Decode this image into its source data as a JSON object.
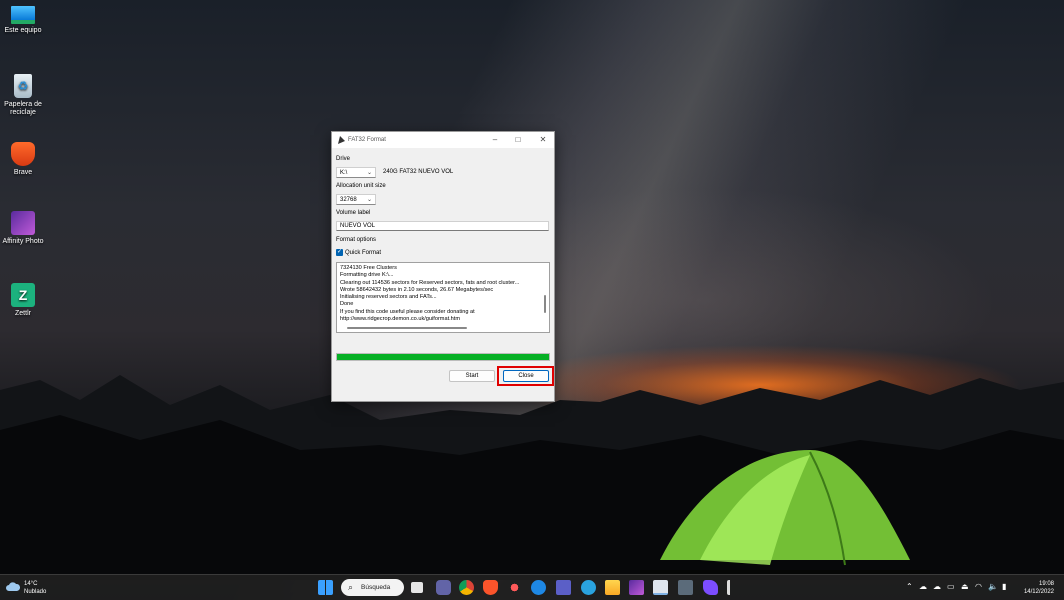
{
  "desktop": {
    "icons": [
      {
        "label": "Este equipo"
      },
      {
        "label": "Papelera de reciclaje"
      },
      {
        "label": "Brave"
      },
      {
        "label": "Affinity Photo"
      },
      {
        "label": "Zettlr"
      }
    ]
  },
  "dialog": {
    "title": "FAT32 Format",
    "drive_label": "Drive",
    "drive_value": "K:\\",
    "drive_info": "240G FAT32 NUEVO VOL",
    "alloc_label": "Allocation unit size",
    "alloc_value": "32768",
    "volume_label_label": "Volume label",
    "volume_label_value": "NUEVO VOL",
    "format_options_label": "Format options",
    "quick_format_label": "Quick Format",
    "quick_format_checked": true,
    "log_lines": [
      "7324130 Free Clusters",
      "Formatting drive K:\\...",
      "Clearing out 114536 sectors for Reserved sectors, fats and root cluster...",
      "Wrote 58642432 bytes in 2.10 seconds, 26.67 Megabytes/sec",
      "Initialising reserved sectors and FATs...",
      "Done",
      "If you find this code useful please consider donating at",
      "http://www.ridgecrop.demon.co.uk/guiformat.htm"
    ],
    "progress_fraction": 1.0,
    "start_label": "Start",
    "close_label": "Close"
  },
  "taskbar": {
    "weather_temp": "14°C",
    "weather_desc": "Nublado",
    "search_label": "Búsqueda",
    "time": "19:08",
    "date": "14/12/2022"
  },
  "colors": {
    "progress": "#06b025",
    "highlight": "#e00000",
    "accent": "#0067c0"
  }
}
